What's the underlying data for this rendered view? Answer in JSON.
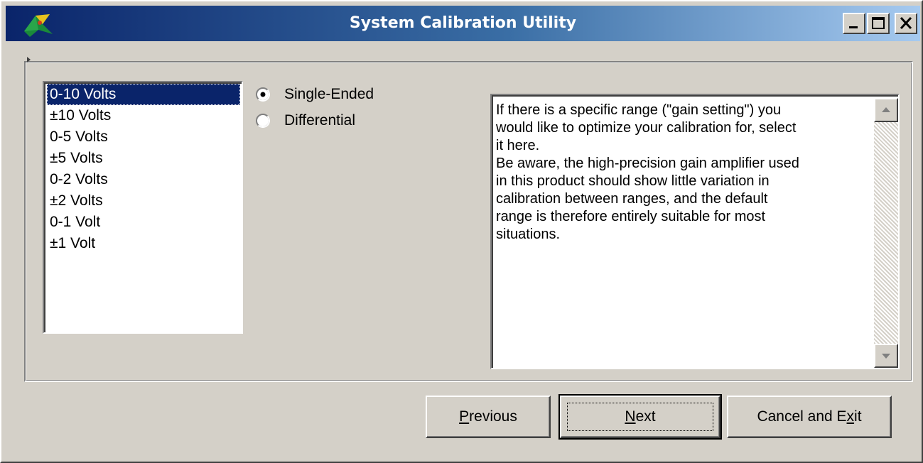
{
  "window": {
    "title": "System Calibration Utility",
    "title_gradient": [
      "#0a246a",
      "#a6caf0"
    ],
    "icon": "app-icon"
  },
  "range_list": {
    "selected": "0-10 Volts",
    "items": [
      "0-10 Volts",
      "±10 Volts",
      "0-5 Volts",
      "±5 Volts",
      "0-2 Volts",
      "±2 Volts",
      "0-1 Volt",
      "±1 Volt"
    ]
  },
  "input_mode": {
    "selected": "Single-Ended",
    "options": [
      "Single-Ended",
      "Differential"
    ]
  },
  "description": {
    "lines": [
      "If there is a specific range (\"gain setting\") you",
      "would like to optimize your calibration for, select",
      "it here.",
      "Be aware, the high-precision gain amplifier used",
      "in this product should show little variation in",
      "calibration between ranges, and the default",
      "range is therefore entirely suitable for most",
      "situations."
    ]
  },
  "buttons": {
    "previous": {
      "label_pre": "",
      "accel": "P",
      "label_post": "revious"
    },
    "next": {
      "label_pre": "",
      "accel": "N",
      "label_post": "ext"
    },
    "cancel": {
      "label_pre": "Cancel and E",
      "accel": "x",
      "label_post": "it"
    }
  }
}
